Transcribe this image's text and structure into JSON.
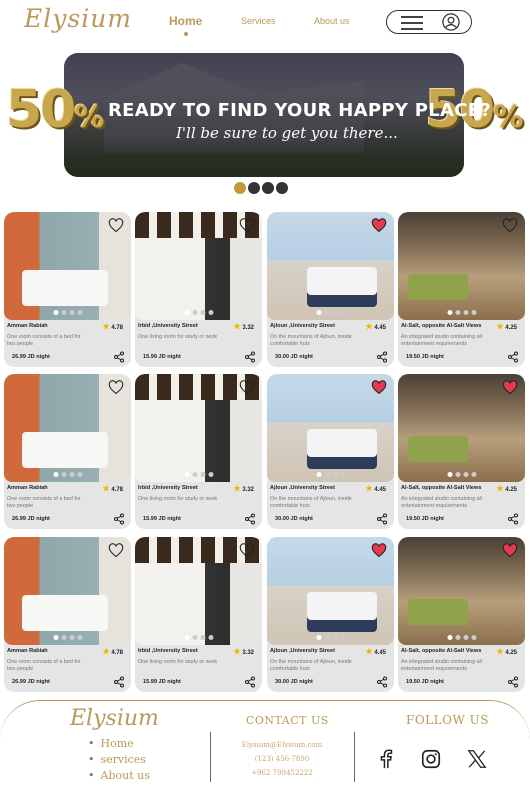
{
  "nav": {
    "logo": "Elysium",
    "links": [
      {
        "label": "Home",
        "active": true
      },
      {
        "label": "Services",
        "active": false
      },
      {
        "label": "About us",
        "active": false
      }
    ],
    "menu_icon": "hamburger-icon",
    "user_icon": "user-icon"
  },
  "hero": {
    "percent_left": "50",
    "percent_right": "50",
    "percent_sign": "%",
    "title": "READY TO FIND YOUR HAPPY PLACE?",
    "subtitle": "I'll be sure to get you there...",
    "slide_count": 4,
    "active_slide": 1
  },
  "colors": {
    "gold": "#b89a5a",
    "dot_active": "#c29a3b",
    "heart_red": "#e53950",
    "star": "#f2b400"
  },
  "listings": [
    {
      "title": "Amman Rabiah",
      "rating": "4.78",
      "desc": "One room consists of a bed for two people",
      "price": "26.99 JD night",
      "liked": false,
      "photo": "p1"
    },
    {
      "title": "Irbid ,University Street",
      "rating": "3.32",
      "desc": "One living room for study or work",
      "price": "15.99 JD night",
      "liked": false,
      "photo": "p2"
    },
    {
      "title": "Ajloun ,University Street",
      "rating": "4.45",
      "desc": "On the mountains of Ajloun, inside comfortable huts",
      "price": "30.00 JD night",
      "liked": true,
      "photo": "p3"
    },
    {
      "title": "Al-Salt, opposite Al-Salt Views",
      "rating": "4.25",
      "desc": "An integrated studio containing all entertainment requirements",
      "price": "19.50 JD night",
      "liked": false,
      "photo": "p4"
    },
    {
      "title": "Amman Rabiah",
      "rating": "4.78",
      "desc": "One room consists of a bed for two people",
      "price": "26.99 JD night",
      "liked": false,
      "photo": "p1"
    },
    {
      "title": "Irbid ,University Street",
      "rating": "3.32",
      "desc": "One living room for study or work",
      "price": "15.99 JD night",
      "liked": false,
      "photo": "p2"
    },
    {
      "title": "Ajloun ,University Street",
      "rating": "4.45",
      "desc": "On the mountains of Ajloun, inside comfortable huts",
      "price": "30.00 JD night",
      "liked": true,
      "photo": "p3"
    },
    {
      "title": "Al-Salt, opposite Al-Salt Views",
      "rating": "4.25",
      "desc": "An integrated studio containing all entertainment requirements",
      "price": "19.50 JD night",
      "liked": true,
      "photo": "p4"
    },
    {
      "title": "Amman Rabiah",
      "rating": "4.78",
      "desc": "One room consists of a bed for two people",
      "price": "26.99 JD night",
      "liked": false,
      "photo": "p1"
    },
    {
      "title": "Irbid ,University Street",
      "rating": "3.32",
      "desc": "One living room for study or work",
      "price": "15.99 JD night",
      "liked": false,
      "photo": "p2"
    },
    {
      "title": "Ajloun ,University Street",
      "rating": "4.45",
      "desc": "On the mountains of Ajloun, inside comfortable huts",
      "price": "30.00 JD night",
      "liked": true,
      "photo": "p3"
    },
    {
      "title": "Al-Salt, opposite Al-Salt Views",
      "rating": "4.25",
      "desc": "An integrated studio containing all entertainment requirements",
      "price": "19.50 JD night",
      "liked": true,
      "photo": "p4"
    }
  ],
  "footer": {
    "logo": "Elysium",
    "links": [
      "Home",
      "services",
      "About us"
    ],
    "contact_heading": "CONTACT US",
    "contact": [
      "Elysium@Elysium.com",
      "(123) 456-7890",
      "+962 798452222"
    ],
    "follow_heading": "FOLLOW US",
    "social_icons": [
      "facebook-icon",
      "instagram-icon",
      "x-twitter-icon"
    ]
  }
}
